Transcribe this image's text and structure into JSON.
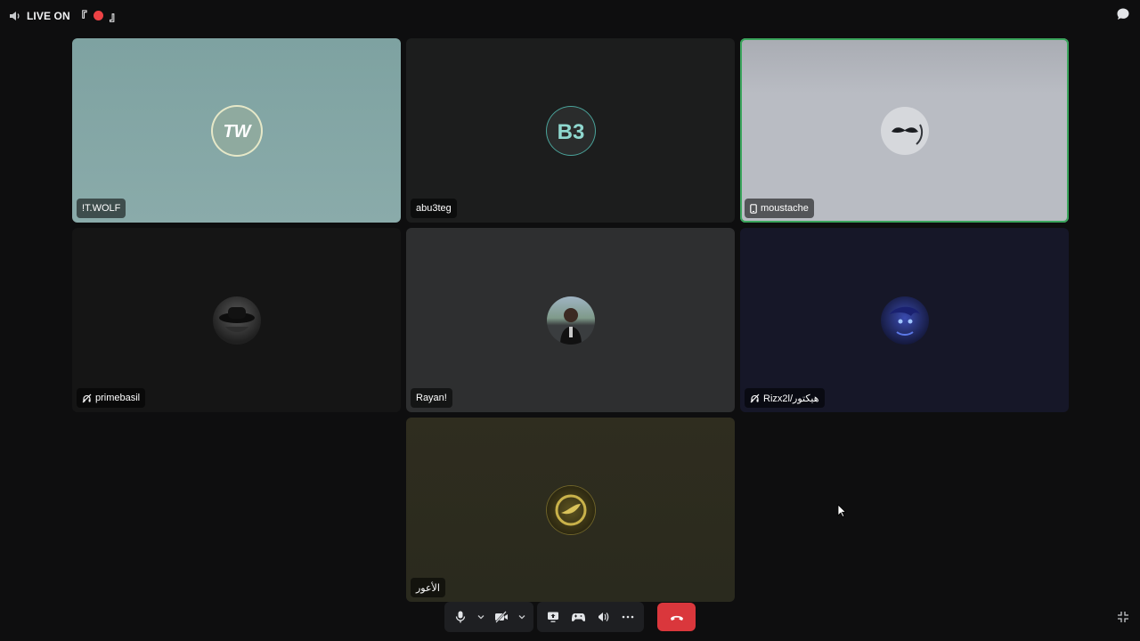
{
  "header": {
    "live_label": "LIVE ON",
    "bracket_open": "『",
    "bracket_close": "』"
  },
  "participants": [
    {
      "name": "!T.WOLF",
      "bg": "#86a8a7",
      "icon": "none",
      "speaking": false,
      "avatar": "tw-logo-avatar"
    },
    {
      "name": "abu3teg",
      "bg": "#1c1d1d",
      "icon": "none",
      "speaking": false,
      "avatar": "b3-logo-avatar"
    },
    {
      "name": "moustache",
      "bg": "#b9bcc3",
      "icon": "mobile-icon",
      "speaking": true,
      "avatar": "moustache-avatar"
    },
    {
      "name": "primebasil",
      "bg": "#151515",
      "icon": "deafened-icon",
      "speaking": false,
      "avatar": "hat-avatar"
    },
    {
      "name": "Rayan!",
      "bg": "#2e2f30",
      "icon": "none",
      "speaking": false,
      "avatar": "photo-avatar"
    },
    {
      "name": "Rizx2l/هيكتور",
      "bg": "#161728",
      "icon": "deafened-icon",
      "speaking": false,
      "avatar": "blue-character-avatar"
    },
    {
      "name": "الأعور",
      "bg": "#2e2c1f",
      "icon": "none",
      "speaking": false,
      "avatar": "gold-emblem-avatar"
    }
  ],
  "controls": {
    "items": [
      "microphone-icon",
      "chevron-down-icon",
      "camera-off-icon",
      "chevron-down-icon",
      "screen-share-icon",
      "activity-icon",
      "soundboard-icon",
      "more-icon"
    ],
    "hangup": "hang-up-icon"
  },
  "colors": {
    "background": "#0e0e0f",
    "speaking_border": "#3ba55d",
    "hangup": "#da373c",
    "live_dot": "#ed4245"
  }
}
